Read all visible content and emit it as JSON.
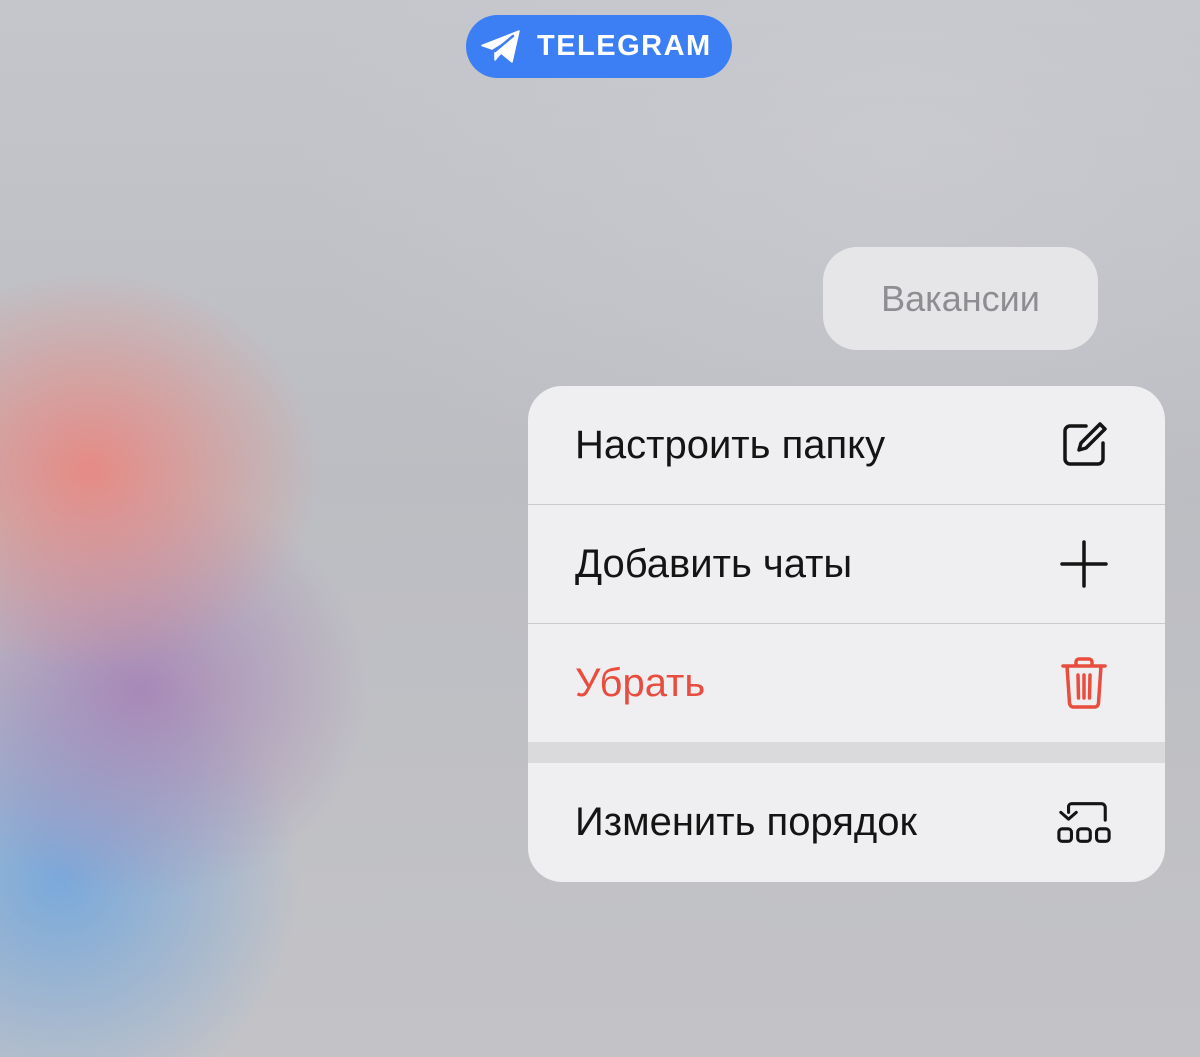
{
  "source_badge": {
    "label": "TELEGRAM",
    "icon": "paper-plane-icon",
    "color": "#3c7ef3"
  },
  "folder_chip": {
    "label": "Вакансии"
  },
  "context_menu": {
    "items": [
      {
        "label": "Настроить папку",
        "icon": "edit-folder-icon"
      },
      {
        "label": "Добавить чаты",
        "icon": "plus-icon"
      },
      {
        "label": "Убрать",
        "icon": "trash-icon",
        "color": "#e84d3f"
      },
      {
        "label": "Изменить порядок",
        "icon": "reorder-icon"
      }
    ]
  }
}
